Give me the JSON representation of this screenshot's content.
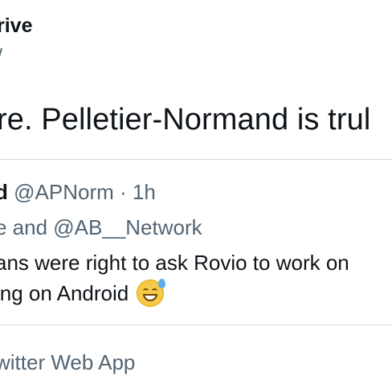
{
  "tweet": {
    "author_name": "rive",
    "author_handle": "/",
    "text": "re. Pelletier-Normand is trul"
  },
  "quoted": {
    "author_name": "d",
    "author_handle": "@APNorm",
    "separator": "·",
    "time": "1h",
    "replying_to": "e and @AB__Network",
    "line1": "ans were right to ask Rovio to work on",
    "line2": "ing on Android",
    "emoji": "grinning-face-with-sweat-icon"
  },
  "source": "witter Web App",
  "colors": {
    "text": "#0f1419",
    "secondary": "#536471",
    "divider": "#cfd9de"
  }
}
